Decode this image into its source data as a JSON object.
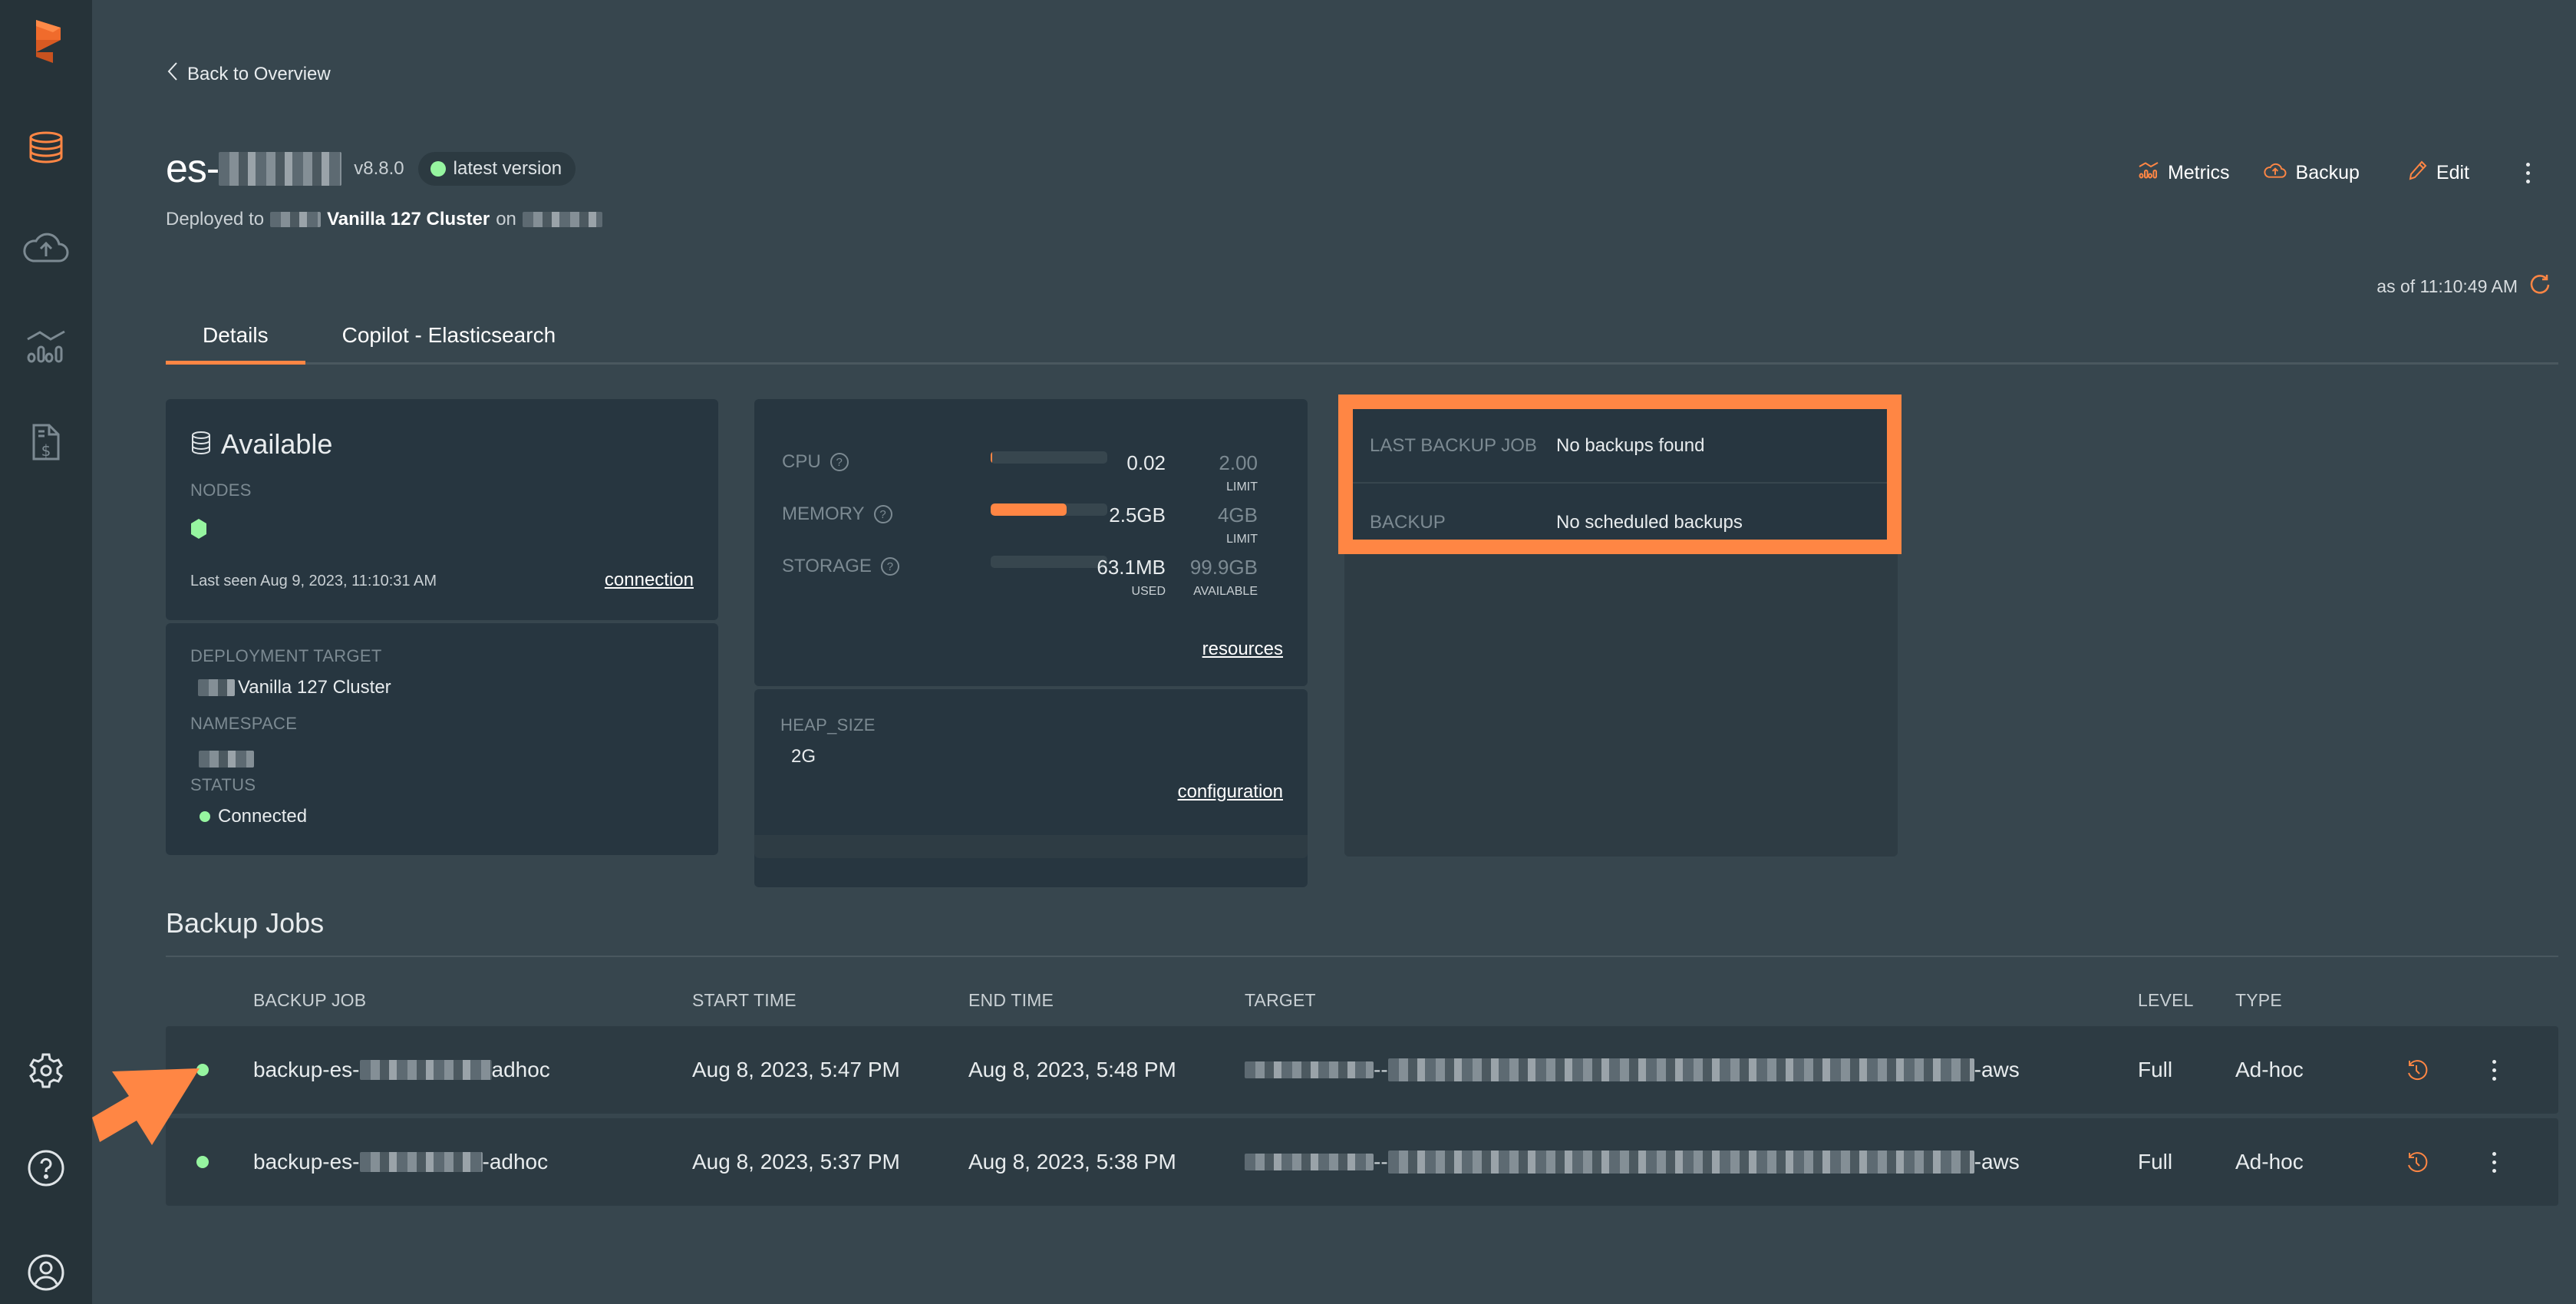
{
  "sidebar": {
    "logo": "portworx-logo-icon",
    "items": [
      {
        "name": "databases",
        "icon": "database-icon",
        "active": true
      },
      {
        "name": "backups",
        "icon": "cloud-upload-icon",
        "active": false
      },
      {
        "name": "metrics",
        "icon": "chart-icon",
        "active": false
      },
      {
        "name": "billing",
        "icon": "invoice-icon",
        "active": false
      }
    ],
    "bottom_items": [
      {
        "name": "settings",
        "icon": "gear-icon"
      },
      {
        "name": "help",
        "icon": "help-icon"
      },
      {
        "name": "profile",
        "icon": "user-icon"
      }
    ]
  },
  "header": {
    "back_label": "Back to Overview",
    "title_prefix": "es-",
    "version": "v8.8.0",
    "version_badge": "latest version",
    "deployed_prefix": "Deployed to",
    "cluster_name": "Vanilla 127 Cluster",
    "deployed_on": "on"
  },
  "actions": {
    "metrics": "Metrics",
    "backup": "Backup",
    "edit": "Edit",
    "as_of": "as of 11:10:49 AM"
  },
  "tabs": [
    {
      "label": "Details",
      "active": true
    },
    {
      "label": "Copilot - Elasticsearch",
      "active": false
    }
  ],
  "status_card": {
    "status": "Available",
    "nodes_label": "NODES",
    "last_seen": "Last seen Aug 9, 2023, 11:10:31 AM",
    "connection_link": "connection",
    "deployment_target_label": "DEPLOYMENT TARGET",
    "deployment_target": "Vanilla 127 Cluster",
    "namespace_label": "NAMESPACE",
    "status_label": "STATUS",
    "connection_status": "Connected"
  },
  "resources": {
    "cpu": {
      "label": "CPU",
      "value": "0.02",
      "limit": "2.00",
      "limit_label": "LIMIT",
      "fill_percent": 1
    },
    "memory": {
      "label": "MEMORY",
      "value": "2.5GB",
      "limit": "4GB",
      "limit_label": "LIMIT",
      "fill_percent": 65
    },
    "storage": {
      "label": "STORAGE",
      "value": "63.1MB",
      "value_label": "USED",
      "limit": "99.9GB",
      "limit_label": "AVAILABLE",
      "fill_percent": 0
    },
    "link": "resources"
  },
  "config": {
    "heap_label": "HEAP_SIZE",
    "heap_value": "2G",
    "link": "configuration"
  },
  "backup_info": {
    "last_job_label": "LAST BACKUP JOB",
    "last_job_value": "No backups found",
    "backup_label": "BACKUP",
    "backup_value": "No scheduled backups"
  },
  "backup_jobs": {
    "title": "Backup Jobs",
    "columns": [
      "BACKUP JOB",
      "START TIME",
      "END TIME",
      "TARGET",
      "LEVEL",
      "TYPE"
    ],
    "rows": [
      {
        "job_prefix": "backup-es-",
        "job_suffix": "adhoc",
        "start": "Aug 8, 2023, 5:47 PM",
        "end": "Aug 8, 2023, 5:48 PM",
        "target_suffix": "-aws",
        "level": "Full",
        "type": "Ad-hoc",
        "status": "success"
      },
      {
        "job_prefix": "backup-es-",
        "job_suffix": "-adhoc",
        "start": "Aug 8, 2023, 5:37 PM",
        "end": "Aug 8, 2023, 5:38 PM",
        "target_suffix": "-aws",
        "level": "Full",
        "type": "Ad-hoc",
        "status": "success"
      }
    ]
  },
  "colors": {
    "accent": "#ff8644",
    "success": "#96f5a0",
    "sidebar_bg": "#263339",
    "page_bg": "#37464e",
    "card_bg": "#273640"
  }
}
